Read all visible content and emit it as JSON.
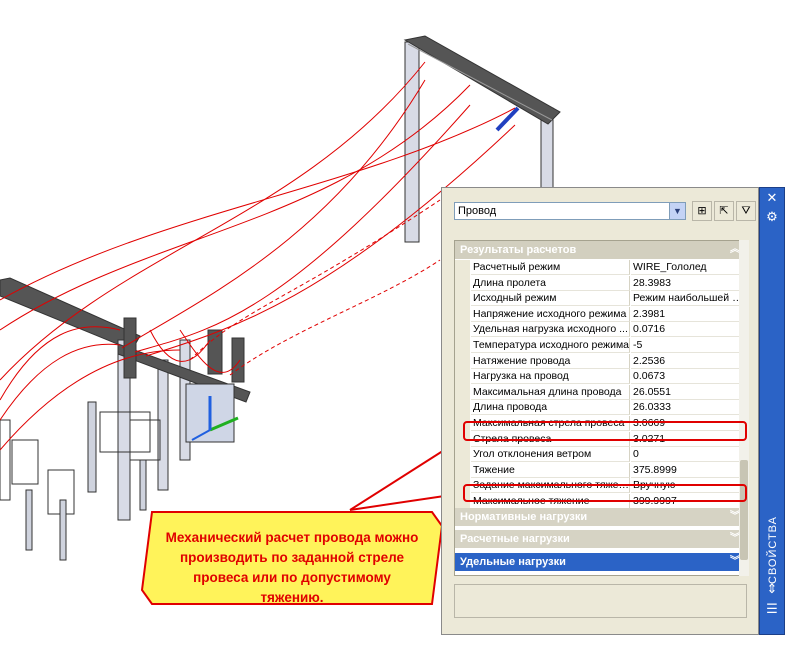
{
  "palette": {
    "object_selector": "Провод",
    "side_title": "СВОЙСТВА",
    "categories": {
      "results": "Результаты расчетов",
      "normative": "Нормативные нагрузки",
      "calculated": "Расчетные нагрузки",
      "specific": "Удельные нагрузки"
    },
    "rows": [
      {
        "name": "Расчетный режим",
        "value": "WIRE_Гололед"
      },
      {
        "name": "Длина пролета",
        "value": "28.3983"
      },
      {
        "name": "Исходный режим",
        "value": "Режим наибольшей на..."
      },
      {
        "name": "Напряжение исходного режима",
        "value": "2.3981"
      },
      {
        "name": "Удельная нагрузка исходного ...",
        "value": "0.0716"
      },
      {
        "name": "Температура исходного режима",
        "value": "-5"
      },
      {
        "name": "Натяжение провода",
        "value": "2.2536"
      },
      {
        "name": "Нагрузка на провод",
        "value": "0.0673"
      },
      {
        "name": "Максимальная длина провода",
        "value": "26.0551"
      },
      {
        "name": "Длина провода",
        "value": "26.0333"
      },
      {
        "name": "Максимальная стрела провеса",
        "value": "3.0669"
      },
      {
        "name": "Стрела провеса",
        "value": "3.0271"
      },
      {
        "name": "Угол отклонения ветром",
        "value": "0"
      },
      {
        "name": "Тяжение",
        "value": "375.8999"
      },
      {
        "name": "Задание максимального тяжения",
        "value": "Вручную"
      },
      {
        "name": "Максимальное тяжение",
        "value": "399.9997"
      }
    ]
  },
  "callout": {
    "text": "Механический расчет провода можно производить по заданной стреле провеса или по допустимому тяжению."
  },
  "colors": {
    "accent": "#2b63c6",
    "highlight": "#e00000",
    "callout_fill": "#fff35a",
    "wire": "#e00000"
  }
}
